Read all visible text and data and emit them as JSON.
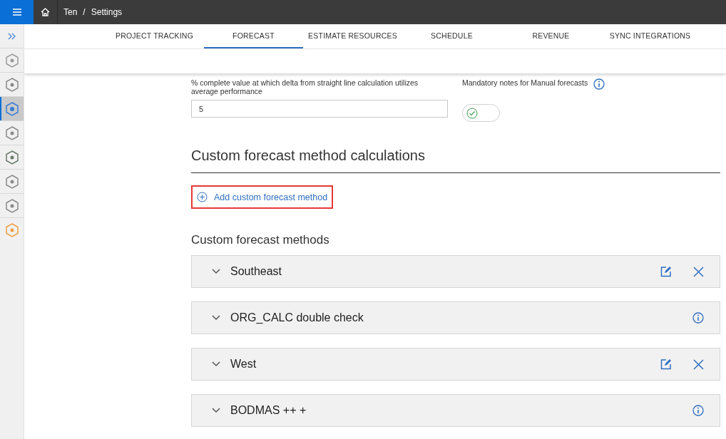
{
  "breadcrumb": {
    "items": [
      "Ten",
      "Settings"
    ],
    "separator": "/"
  },
  "rail": [
    {
      "selected": false,
      "color": "#9a9a9a"
    },
    {
      "selected": false,
      "color": "#8a8a8a"
    },
    {
      "selected": true,
      "color": "#3a7bd5"
    },
    {
      "selected": false,
      "color": "#8a8a8a"
    },
    {
      "selected": false,
      "color": "#6a7a6a"
    },
    {
      "selected": false,
      "color": "#8a8a8a"
    },
    {
      "selected": false,
      "color": "#8a8a8a"
    },
    {
      "selected": false,
      "color": "#f0a040"
    }
  ],
  "tabs": [
    {
      "label": "PROJECT TRACKING",
      "selected": false
    },
    {
      "label": "FORECAST",
      "selected": true
    },
    {
      "label": "ESTIMATE RESOURCES",
      "selected": false
    },
    {
      "label": "SCHEDULE",
      "selected": false
    },
    {
      "label": "REVENUE",
      "selected": false
    },
    {
      "label": "SYNC INTEGRATIONS",
      "selected": false
    }
  ],
  "threshold_field": {
    "label": "% complete value at which delta from straight line calculation utilizes average performance",
    "value": "5"
  },
  "mandatory_notes": {
    "label": "Mandatory notes for Manual forecasts",
    "on": true
  },
  "calculations": {
    "heading": "Custom forecast method calculations",
    "add_link": "Add custom forecast method"
  },
  "methods": {
    "heading": "Custom forecast methods",
    "items": [
      {
        "name": "Southeast",
        "kind": "editable",
        "expanded": false
      },
      {
        "name": "ORG_CALC double check",
        "kind": "readonly",
        "expanded": false
      },
      {
        "name": "West",
        "kind": "editable",
        "expanded": false
      },
      {
        "name": "BODMAS ++ +",
        "kind": "readonly",
        "expanded": false
      }
    ]
  }
}
